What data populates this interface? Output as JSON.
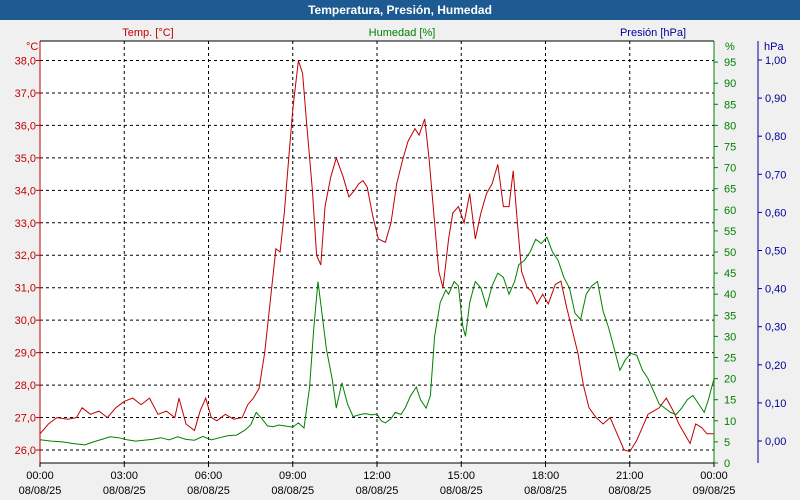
{
  "window": {
    "title": "Temperatura, Presión, Humedad"
  },
  "colors": {
    "temp": "#c00000",
    "hum": "#008000",
    "pres": "#000099",
    "titlebar": "#1d5a92",
    "grid": "#000000"
  },
  "chart_data": {
    "type": "line",
    "title": "Temperatura, Presión, Humedad",
    "grid": true,
    "x_ticks": [
      {
        "t": 0,
        "time": "00:00",
        "date": "08/08/25"
      },
      {
        "t": 3,
        "time": "03:00",
        "date": "08/08/25"
      },
      {
        "t": 6,
        "time": "06:00",
        "date": "08/08/25"
      },
      {
        "t": 9,
        "time": "09:00",
        "date": "08/08/25"
      },
      {
        "t": 12,
        "time": "12:00",
        "date": "08/08/25"
      },
      {
        "t": 15,
        "time": "15:00",
        "date": "08/08/25"
      },
      {
        "t": 18,
        "time": "18:00",
        "date": "08/08/25"
      },
      {
        "t": 21,
        "time": "21:00",
        "date": "08/08/25"
      },
      {
        "t": 24,
        "time": "00:00",
        "date": "09/08/25"
      }
    ],
    "xlim": [
      0,
      24
    ],
    "axes": {
      "temp": {
        "label": "Temp. [°C]",
        "unit": "°C",
        "ylim": [
          25.6,
          38.6
        ],
        "ticks": [
          "26,0",
          "27,0",
          "28,0",
          "29,0",
          "30,0",
          "31,0",
          "32,0",
          "33,0",
          "34,0",
          "35,0",
          "36,0",
          "37,0",
          "38,0"
        ],
        "tick_values": [
          26,
          27,
          28,
          29,
          30,
          31,
          32,
          33,
          34,
          35,
          36,
          37,
          38
        ]
      },
      "hum": {
        "label": "Humedad [%]",
        "unit": "%",
        "ylim": [
          0,
          100
        ],
        "ticks": [
          "0",
          "5",
          "10",
          "15",
          "20",
          "25",
          "30",
          "35",
          "40",
          "45",
          "50",
          "55",
          "60",
          "65",
          "70",
          "75",
          "80",
          "85",
          "90",
          "95"
        ],
        "tick_values": [
          0,
          5,
          10,
          15,
          20,
          25,
          30,
          35,
          40,
          45,
          50,
          55,
          60,
          65,
          70,
          75,
          80,
          85,
          90,
          95
        ]
      },
      "pres": {
        "label": "Presión [hPa]",
        "unit": "hPa",
        "ticks": [
          "0,00",
          "0,10",
          "0,20",
          "0,30",
          "0,40",
          "0,50",
          "0,60",
          "0,70",
          "0,80",
          "0,90",
          "1,00"
        ],
        "tick_values": [
          0,
          0.1,
          0.2,
          0.3,
          0.4,
          0.5,
          0.6,
          0.7,
          0.8,
          0.9,
          1.0
        ]
      }
    },
    "series": [
      {
        "name": "Temp. [°C]",
        "axis": "temp",
        "data": [
          [
            0,
            26.5
          ],
          [
            0.3,
            26.8
          ],
          [
            0.6,
            27.0
          ],
          [
            1,
            26.95
          ],
          [
            1.3,
            27.0
          ],
          [
            1.5,
            27.3
          ],
          [
            1.8,
            27.1
          ],
          [
            2.1,
            27.2
          ],
          [
            2.4,
            27.0
          ],
          [
            2.7,
            27.3
          ],
          [
            3,
            27.5
          ],
          [
            3.3,
            27.6
          ],
          [
            3.6,
            27.4
          ],
          [
            3.9,
            27.6
          ],
          [
            4.2,
            27.1
          ],
          [
            4.5,
            27.2
          ],
          [
            4.8,
            27.0
          ],
          [
            4.95,
            27.6
          ],
          [
            5.2,
            26.8
          ],
          [
            5.5,
            26.6
          ],
          [
            5.7,
            27.2
          ],
          [
            5.9,
            27.6
          ],
          [
            6.1,
            27.0
          ],
          [
            6.3,
            26.9
          ],
          [
            6.6,
            27.1
          ],
          [
            6.9,
            26.95
          ],
          [
            7.2,
            27.0
          ],
          [
            7.4,
            27.4
          ],
          [
            7.6,
            27.6
          ],
          [
            7.8,
            27.9
          ],
          [
            8.0,
            29.0
          ],
          [
            8.2,
            30.6
          ],
          [
            8.4,
            32.2
          ],
          [
            8.55,
            32.1
          ],
          [
            8.7,
            33.3
          ],
          [
            8.85,
            34.9
          ],
          [
            9.0,
            36.5
          ],
          [
            9.2,
            38.0
          ],
          [
            9.35,
            37.6
          ],
          [
            9.5,
            36.0
          ],
          [
            9.7,
            34.0
          ],
          [
            9.85,
            32.0
          ],
          [
            10.0,
            31.7
          ],
          [
            10.15,
            33.5
          ],
          [
            10.35,
            34.4
          ],
          [
            10.55,
            35.0
          ],
          [
            10.8,
            34.4
          ],
          [
            11.0,
            33.8
          ],
          [
            11.2,
            34.0
          ],
          [
            11.35,
            34.2
          ],
          [
            11.5,
            34.3
          ],
          [
            11.65,
            34.1
          ],
          [
            11.85,
            33.2
          ],
          [
            12.05,
            32.5
          ],
          [
            12.3,
            32.4
          ],
          [
            12.5,
            33.0
          ],
          [
            12.7,
            34.2
          ],
          [
            12.9,
            34.9
          ],
          [
            13.1,
            35.5
          ],
          [
            13.35,
            35.9
          ],
          [
            13.5,
            35.7
          ],
          [
            13.7,
            36.2
          ],
          [
            13.85,
            35.0
          ],
          [
            14.05,
            33.0
          ],
          [
            14.2,
            31.5
          ],
          [
            14.35,
            31.0
          ],
          [
            14.55,
            32.5
          ],
          [
            14.7,
            33.3
          ],
          [
            14.9,
            33.5
          ],
          [
            15.1,
            33.0
          ],
          [
            15.3,
            33.9
          ],
          [
            15.5,
            32.5
          ],
          [
            15.7,
            33.3
          ],
          [
            15.9,
            33.9
          ],
          [
            16.1,
            34.2
          ],
          [
            16.3,
            34.8
          ],
          [
            16.5,
            33.5
          ],
          [
            16.7,
            33.5
          ],
          [
            16.85,
            34.6
          ],
          [
            17.0,
            33.0
          ],
          [
            17.15,
            31.5
          ],
          [
            17.35,
            31.0
          ],
          [
            17.5,
            30.9
          ],
          [
            17.7,
            30.5
          ],
          [
            17.9,
            30.8
          ],
          [
            18.1,
            30.5
          ],
          [
            18.35,
            31.1
          ],
          [
            18.55,
            31.2
          ],
          [
            18.75,
            30.4
          ],
          [
            18.95,
            29.7
          ],
          [
            19.15,
            29.0
          ],
          [
            19.35,
            28.0
          ],
          [
            19.55,
            27.3
          ],
          [
            19.8,
            27.0
          ],
          [
            20.05,
            26.8
          ],
          [
            20.3,
            27.0
          ],
          [
            20.55,
            26.5
          ],
          [
            20.8,
            26.0
          ],
          [
            21.0,
            25.95
          ],
          [
            21.25,
            26.3
          ],
          [
            21.45,
            26.7
          ],
          [
            21.65,
            27.1
          ],
          [
            21.85,
            27.2
          ],
          [
            22.05,
            27.3
          ],
          [
            22.3,
            27.6
          ],
          [
            22.55,
            27.2
          ],
          [
            22.75,
            26.8
          ],
          [
            22.95,
            26.5
          ],
          [
            23.15,
            26.2
          ],
          [
            23.35,
            26.8
          ],
          [
            23.55,
            26.7
          ],
          [
            23.75,
            26.5
          ],
          [
            24.0,
            26.5
          ]
        ]
      },
      {
        "name": "Humedad [%]",
        "axis": "hum",
        "data": [
          [
            0,
            5.5
          ],
          [
            0.4,
            5.2
          ],
          [
            0.8,
            5.0
          ],
          [
            1.2,
            4.6
          ],
          [
            1.6,
            4.3
          ],
          [
            1.9,
            5.0
          ],
          [
            2.2,
            5.6
          ],
          [
            2.5,
            6.2
          ],
          [
            2.8,
            6.0
          ],
          [
            3.1,
            5.5
          ],
          [
            3.4,
            5.2
          ],
          [
            3.7,
            5.4
          ],
          [
            4.0,
            5.6
          ],
          [
            4.3,
            6.0
          ],
          [
            4.6,
            5.5
          ],
          [
            4.9,
            6.2
          ],
          [
            5.2,
            5.6
          ],
          [
            5.5,
            5.4
          ],
          [
            5.8,
            6.3
          ],
          [
            6.1,
            5.5
          ],
          [
            6.4,
            6.0
          ],
          [
            6.7,
            6.5
          ],
          [
            7.0,
            6.6
          ],
          [
            7.3,
            7.8
          ],
          [
            7.5,
            9.0
          ],
          [
            7.7,
            12.0
          ],
          [
            7.9,
            10.5
          ],
          [
            8.1,
            8.8
          ],
          [
            8.3,
            8.6
          ],
          [
            8.5,
            9.0
          ],
          [
            8.7,
            8.8
          ],
          [
            9.0,
            8.5
          ],
          [
            9.2,
            9.5
          ],
          [
            9.4,
            8.3
          ],
          [
            9.6,
            18.0
          ],
          [
            9.75,
            32.0
          ],
          [
            9.9,
            43.0
          ],
          [
            10.05,
            35.0
          ],
          [
            10.2,
            27.0
          ],
          [
            10.4,
            20.0
          ],
          [
            10.55,
            13.0
          ],
          [
            10.75,
            19.0
          ],
          [
            10.95,
            14.0
          ],
          [
            11.15,
            11.0
          ],
          [
            11.4,
            11.5
          ],
          [
            11.6,
            11.7
          ],
          [
            11.8,
            11.4
          ],
          [
            12.0,
            11.6
          ],
          [
            12.15,
            10.0
          ],
          [
            12.3,
            9.5
          ],
          [
            12.5,
            10.5
          ],
          [
            12.65,
            12.0
          ],
          [
            12.85,
            11.5
          ],
          [
            13.0,
            13.0
          ],
          [
            13.2,
            16.0
          ],
          [
            13.4,
            18.0
          ],
          [
            13.55,
            15.0
          ],
          [
            13.75,
            13.0
          ],
          [
            13.9,
            16.0
          ],
          [
            14.05,
            30.0
          ],
          [
            14.25,
            38.0
          ],
          [
            14.45,
            41.0
          ],
          [
            14.55,
            40.0
          ],
          [
            14.75,
            43.0
          ],
          [
            14.9,
            42.0
          ],
          [
            15.05,
            32.5
          ],
          [
            15.15,
            30.0
          ],
          [
            15.3,
            38.0
          ],
          [
            15.5,
            43.0
          ],
          [
            15.7,
            41.5
          ],
          [
            15.9,
            37.0
          ],
          [
            16.1,
            42.0
          ],
          [
            16.3,
            45.0
          ],
          [
            16.5,
            44.0
          ],
          [
            16.7,
            40.0
          ],
          [
            16.9,
            43.0
          ],
          [
            17.05,
            47.0
          ],
          [
            17.25,
            48.0
          ],
          [
            17.45,
            50.0
          ],
          [
            17.65,
            53.0
          ],
          [
            17.85,
            52.0
          ],
          [
            18.05,
            53.5
          ],
          [
            18.25,
            50.0
          ],
          [
            18.45,
            48.0
          ],
          [
            18.65,
            44.0
          ],
          [
            18.85,
            41.5
          ],
          [
            19.05,
            35.5
          ],
          [
            19.25,
            34.0
          ],
          [
            19.45,
            40.0
          ],
          [
            19.65,
            42.0
          ],
          [
            19.85,
            43.0
          ],
          [
            20.05,
            36.0
          ],
          [
            20.25,
            32.0
          ],
          [
            20.45,
            27.0
          ],
          [
            20.65,
            22.0
          ],
          [
            20.85,
            24.5
          ],
          [
            21.05,
            26.0
          ],
          [
            21.25,
            25.5
          ],
          [
            21.45,
            22.0
          ],
          [
            21.65,
            20.0
          ],
          [
            21.85,
            17.0
          ],
          [
            22.05,
            14.0
          ],
          [
            22.25,
            13.0
          ],
          [
            22.45,
            12.0
          ],
          [
            22.65,
            11.5
          ],
          [
            22.85,
            13.0
          ],
          [
            23.05,
            15.0
          ],
          [
            23.25,
            16.0
          ],
          [
            23.45,
            14.0
          ],
          [
            23.65,
            12.0
          ],
          [
            23.8,
            15.0
          ],
          [
            24.0,
            20.0
          ]
        ]
      }
    ]
  }
}
